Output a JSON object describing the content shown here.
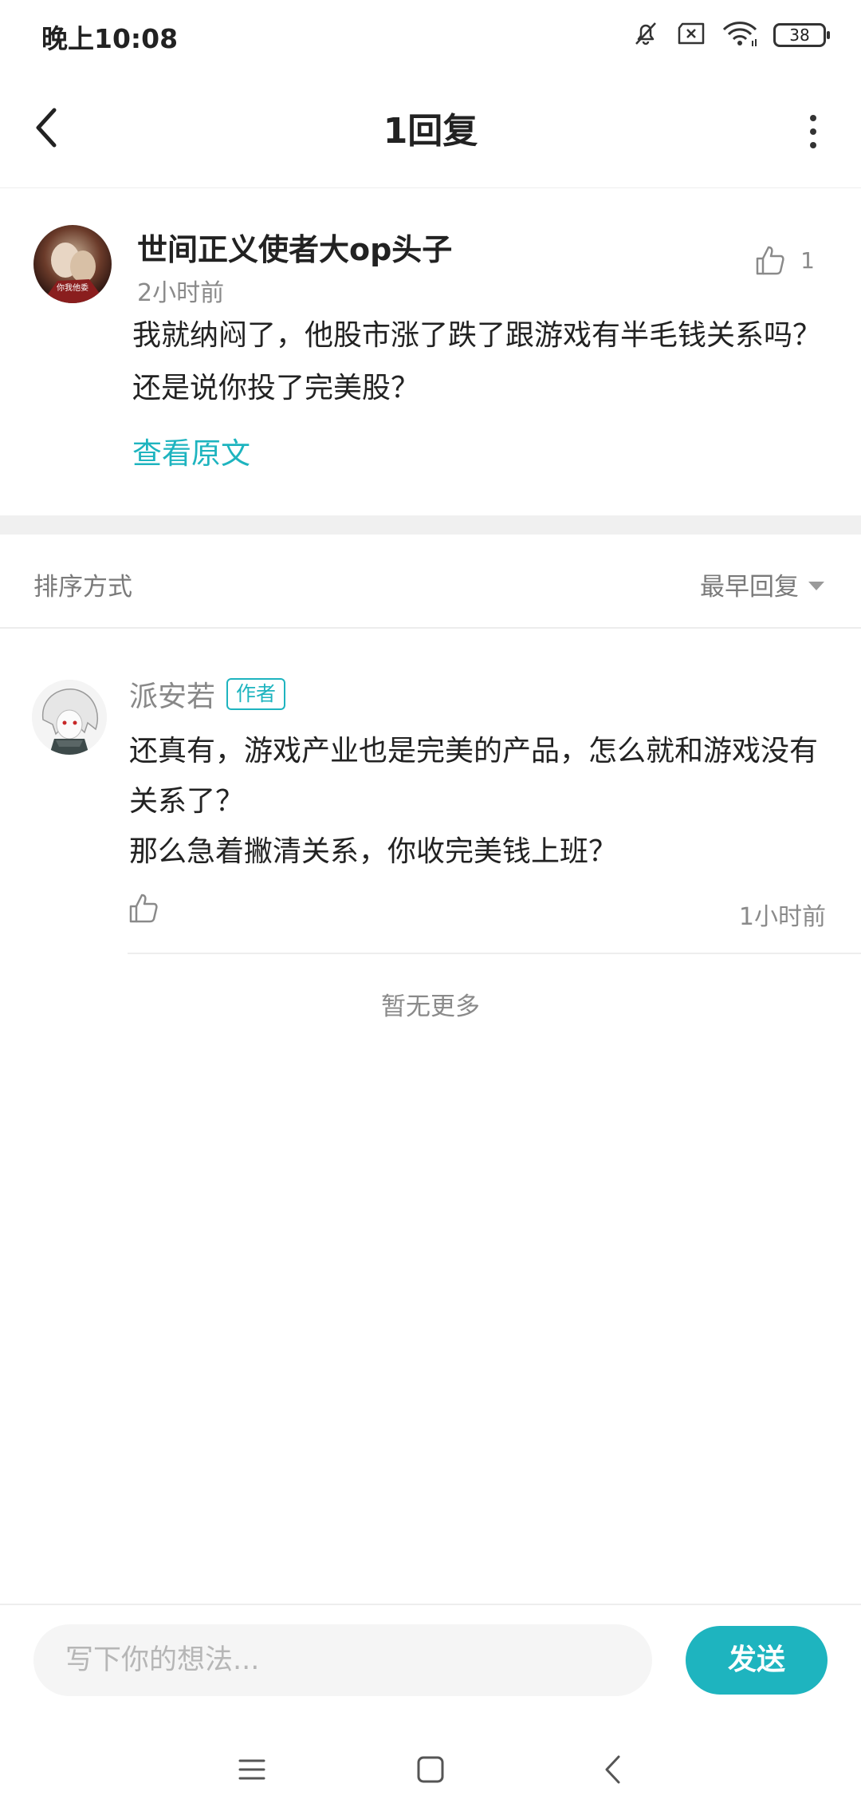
{
  "status_bar": {
    "time": "晚上10:08",
    "battery": "38",
    "icons": [
      "bell-off-icon",
      "sim-error-icon",
      "wifi-icon",
      "battery-icon"
    ]
  },
  "header": {
    "title": "1回复",
    "back_icon": "chevron-left-icon",
    "more_icon": "more-vertical-icon"
  },
  "original_comment": {
    "author": "世间正义使者大op头子",
    "time": "2小时前",
    "likes": "1",
    "content": "我就纳闷了，他股市涨了跌了跟游戏有半毛钱关系吗？还是说你投了完美股？",
    "view_original": "查看原文",
    "avatar_caption": "你我他委"
  },
  "sort": {
    "label": "排序方式",
    "selected": "最早回复"
  },
  "replies": [
    {
      "author": "派安若",
      "badge": "作者",
      "lines": [
        "还真有，游戏产业也是完美的产品，怎么就和游戏没有关系了？",
        "那么急着撇清关系，你收完美钱上班？"
      ],
      "time": "1小时前"
    }
  ],
  "footer_note": "暂无更多",
  "compose": {
    "placeholder": "写下你的想法...",
    "send_label": "发送"
  },
  "colors": {
    "accent": "#1eb4bf",
    "muted_text": "#8a8a8a",
    "separator": "#f0f0f0"
  }
}
